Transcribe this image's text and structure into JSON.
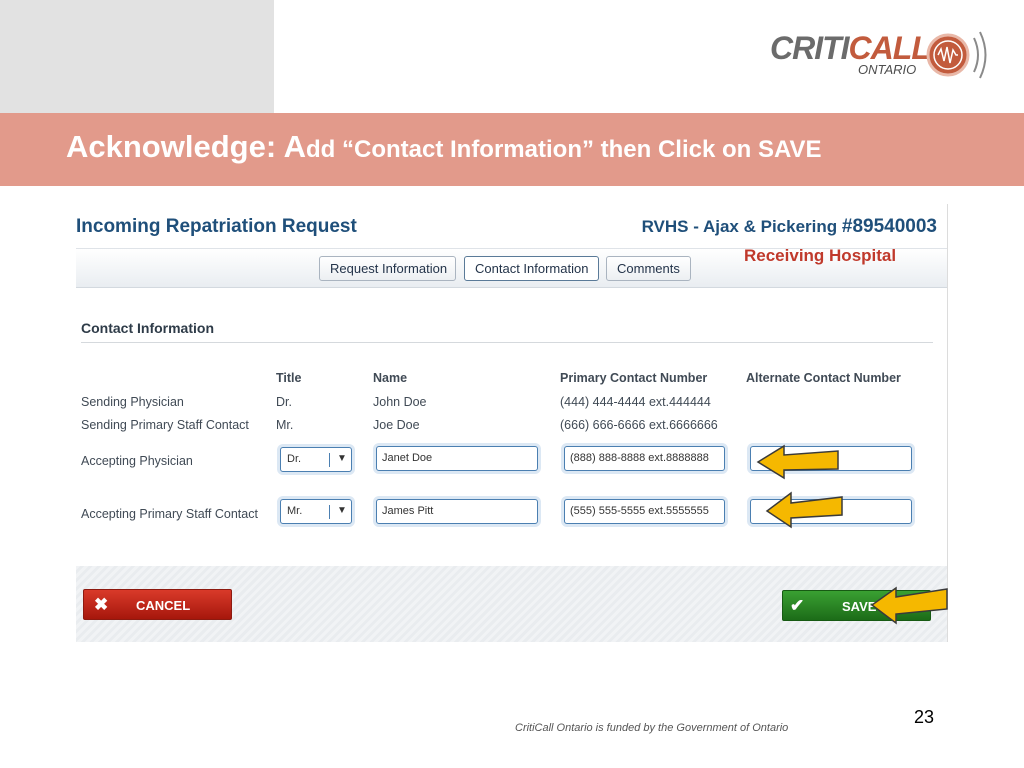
{
  "slide": {
    "title_big": "Acknowledge: A",
    "title_rest": "dd “Contact Information” then Click on SAVE",
    "logo_critic": "CRITI",
    "logo_call": "CALL",
    "logo_ontario": "ONTARIO",
    "page_number": "23",
    "funded_note": "CritiCall Ontario is funded by the Government of Ontario"
  },
  "app": {
    "title": "Incoming Repatriation Request",
    "hospital": "RVHS - Ajax & Pickering",
    "request_number": "#89540003",
    "receiving_note": "Receiving Hospital",
    "tabs": [
      {
        "label": "Request Information"
      },
      {
        "label": "Contact Information"
      },
      {
        "label": "Comments"
      }
    ],
    "section_title": "Contact Information",
    "columns": {
      "title": "Title",
      "name": "Name",
      "primary": "Primary Contact Number",
      "alternate": "Alternate Contact Number"
    },
    "rows": [
      {
        "label": "Sending Physician",
        "title": "Dr.",
        "name": "John Doe",
        "primary": "(444) 444-4444 ext.444444",
        "alternate": ""
      },
      {
        "label": "Sending Primary Staff Contact",
        "title": "Mr.",
        "name": "Joe Doe",
        "primary": "(666) 666-6666 ext.6666666",
        "alternate": ""
      },
      {
        "label": "Accepting Physician",
        "title": "Dr.",
        "name": "Janet Doe",
        "primary": "(888) 888-8888 ext.8888888",
        "alternate": ""
      },
      {
        "label": "Accepting Primary Staff Contact",
        "title": "Mr.",
        "name": "James Pitt",
        "primary": "(555) 555-5555 ext.5555555",
        "alternate": ""
      }
    ],
    "cancel_label": "CANCEL",
    "save_label": "SAVE"
  },
  "colors": {
    "banner": "#e29a8b",
    "brand_blue": "#1f4f7a",
    "receiving_red": "#c0392b",
    "cancel_red": "#c2281a",
    "save_green": "#2a8a23",
    "arrow_yellow": "#f5b800"
  },
  "icons": {
    "cancel": "close-icon",
    "save": "check-icon",
    "select": "chevron-down-icon",
    "annotation": "arrow-left-icon"
  }
}
